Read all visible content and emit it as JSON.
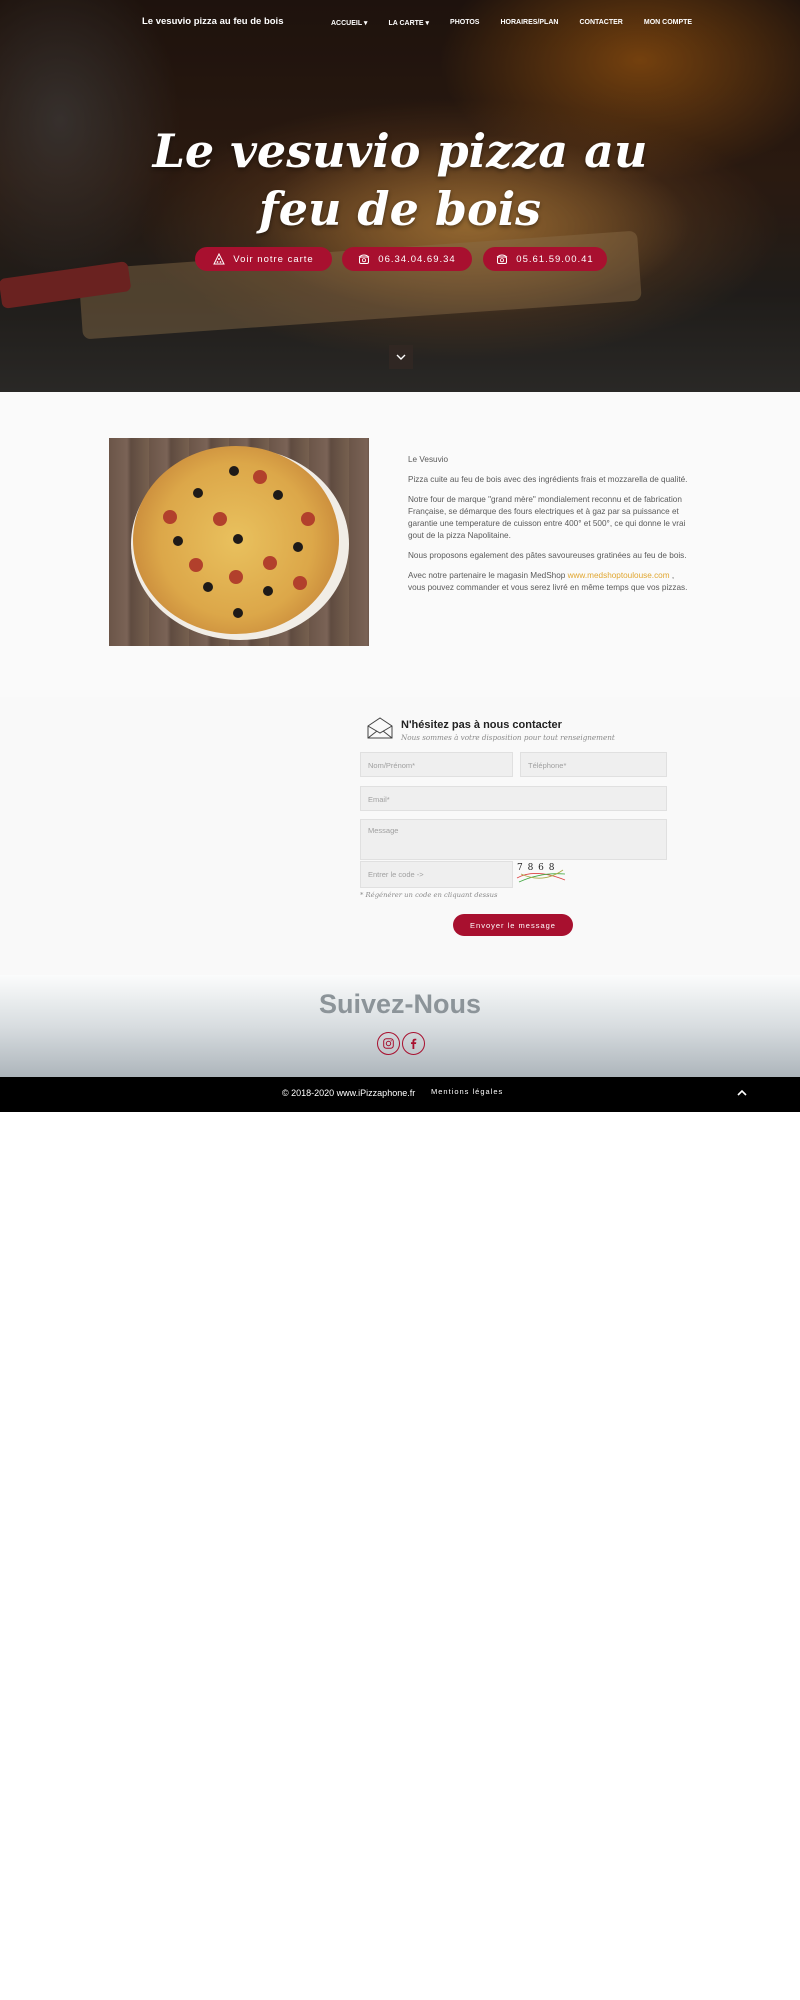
{
  "nav": {
    "brand": "Le vesuvio pizza au feu de bois",
    "items": [
      "Accueil ▾",
      "La carte ▾",
      "Photos",
      "Horaires/Plan",
      "Contacter",
      "Mon compte"
    ]
  },
  "hero": {
    "title": "Le vesuvio pizza au feu de bois",
    "buttons": {
      "menu": "Voir notre carte",
      "phone1": "06.34.04.69.34",
      "phone2": "05.61.59.00.41"
    }
  },
  "about": {
    "p1": "Le Vesuvio",
    "p2": "Pizza cuite au feu de bois avec des ingrédients frais et mozzarella de qualité.",
    "p3": "Notre four de marque \"grand mère\" mondialement reconnu et de fabrication Française, se démarque des fours electriques et à gaz par sa puissance et garantie une temperature de cuisson entre 400° et 500°, ce qui donne le vrai gout de la pizza Napolitaine.",
    "p4": "Nous proposons egalement des pâtes savoureuses gratinées au feu de bois.",
    "p5_before": "Avec notre partenaire le magasin MedShop ",
    "p5_link": "www.medshoptoulouse.com",
    "p5_after": " , vous pouvez commander et vous serez livré en même temps que vos pizzas."
  },
  "contact": {
    "title": "N'hésitez pas à nous contacter",
    "subtitle": "Nous sommes à votre disposition pour tout renseignement",
    "name_placeholder": "Nom/Prénom*",
    "phone_placeholder": "Téléphone*",
    "email_placeholder": "Email*",
    "message_placeholder": "Message",
    "code_placeholder": "Entrer le code ->",
    "captcha": "7 8 6 8",
    "hint": "* Régénérer un code en cliquant dessus",
    "send": "Envoyer le message"
  },
  "follow": {
    "title": "Suivez-Nous",
    "icons": [
      "instagram-icon",
      "facebook-icon"
    ]
  },
  "footer": {
    "copyright": "© 2018-2020 www.iPizzaphone.fr",
    "legal": "Mentions légales"
  },
  "colors": {
    "accent": "#a8102f",
    "link": "#e0a630",
    "footer": "#000000"
  }
}
